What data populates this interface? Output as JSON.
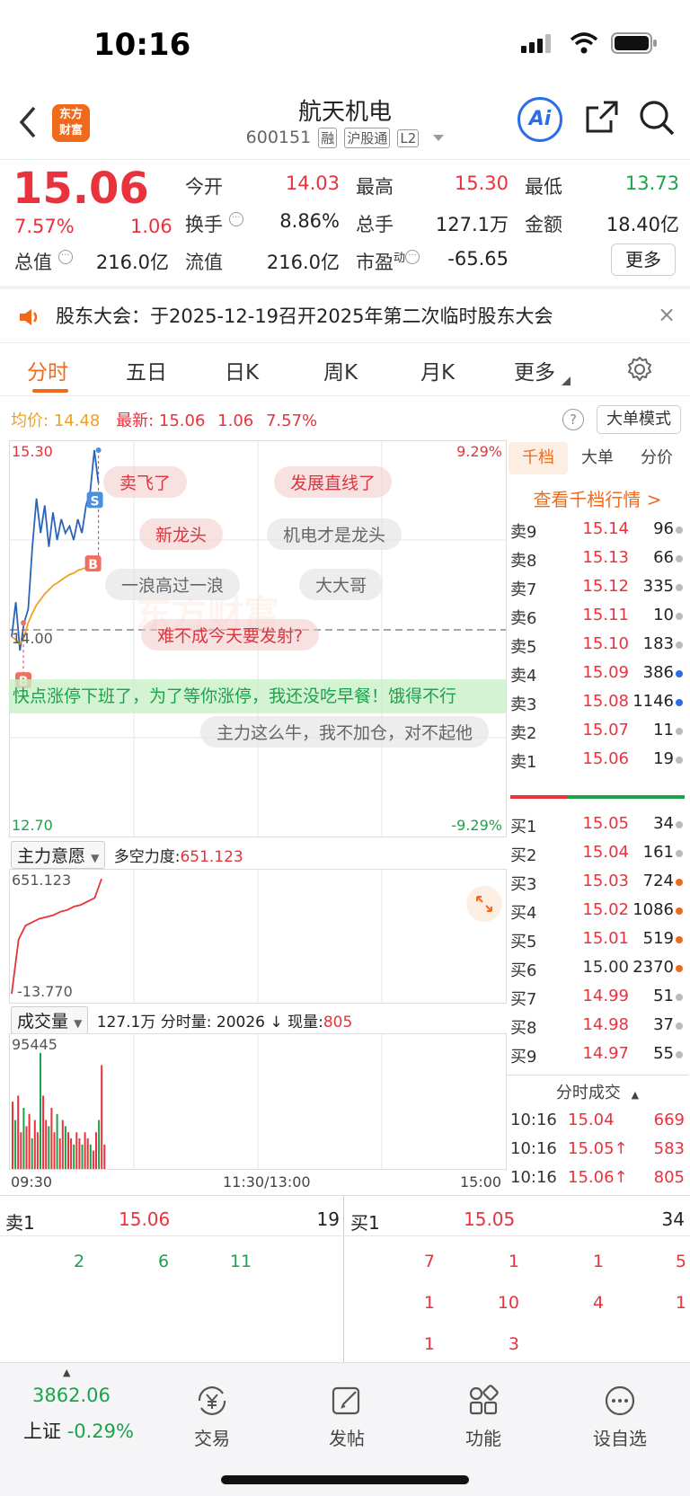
{
  "status": {
    "time": "10:16"
  },
  "header": {
    "logo_line1": "东方",
    "logo_line2": "财富",
    "name": "航天机电",
    "code": "600151",
    "tags": [
      "融",
      "沪股通",
      "L2"
    ],
    "ai_label": "Ai"
  },
  "quote": {
    "price": "15.06",
    "pct": "7.57%",
    "change": "1.06",
    "fields": [
      {
        "label": "今开",
        "value": "14.03",
        "color": "red"
      },
      {
        "label": "最高",
        "value": "15.30",
        "color": "red"
      },
      {
        "label": "最低",
        "value": "13.73",
        "color": "green"
      },
      {
        "label": "换手",
        "value": "8.86%",
        "color": "normal"
      },
      {
        "label": "总手",
        "value": "127.1万",
        "color": "normal"
      },
      {
        "label": "金额",
        "value": "18.40亿",
        "color": "normal"
      },
      {
        "label": "总值",
        "value": "216.0亿",
        "color": "normal"
      },
      {
        "label": "流值",
        "value": "216.0亿",
        "color": "normal"
      },
      {
        "label": "市盈",
        "value": "-65.65",
        "color": "normal"
      }
    ],
    "pe_sup": "动",
    "more_label": "更多"
  },
  "notice": {
    "text": "股东大会：于2025-12-19召开2025年第二次临时股东大会",
    "close": "×"
  },
  "tabs": [
    "分时",
    "五日",
    "日K",
    "周K",
    "月K",
    "更多"
  ],
  "chart_header": {
    "avg_label": "均价:",
    "avg_value": "14.48",
    "latest_label": "最新:",
    "latest_value": "15.06",
    "latest_change": "1.06",
    "latest_pct": "7.57%",
    "bigorder_label": "大单模式",
    "help": "?"
  },
  "chart_data": {
    "type": "line",
    "y_top_label": "15.30",
    "y_mid_label": "14.00",
    "y_bottom_label": "12.70",
    "pct_top_label": "9.29%",
    "pct_bottom_label": "-9.29%",
    "ylim": [
      12.7,
      15.3
    ],
    "x_labels": [
      "09:30",
      "11:30/13:00",
      "15:00"
    ],
    "series": [
      {
        "values": [
          13.95,
          14.2,
          13.85,
          14.05,
          14.15,
          14.6,
          14.95,
          14.7,
          14.9,
          14.6,
          14.85,
          14.65,
          14.8,
          14.7,
          14.75,
          14.65,
          14.8,
          14.7,
          14.9,
          15.0,
          15.3,
          15.06
        ]
      },
      {
        "values": [
          13.95,
          13.93,
          13.9,
          13.95,
          14.05,
          14.12,
          14.18,
          14.22,
          14.26,
          14.29,
          14.32,
          14.34,
          14.36,
          14.38,
          14.4,
          14.41,
          14.43,
          14.44,
          14.45,
          14.46,
          14.47,
          14.48
        ]
      }
    ],
    "markers": [
      "S",
      "B",
      "B"
    ],
    "watermark": "东方财富"
  },
  "comments": {
    "red": [
      "卖飞了",
      "发展直线了",
      "新龙头",
      "难不成今天要发射?"
    ],
    "gray": [
      "机电才是龙头",
      "一浪高过一浪",
      "大大哥",
      "主力这么牛，我不加仓，对不起他"
    ],
    "banner": "快点涨停下班了，为了等你涨停，我还没吃早餐！饿得不行"
  },
  "indicator1": {
    "name": "主力意愿",
    "label": "多空力度:",
    "value": "651.123",
    "top": "651.123",
    "bottom": "-13.770",
    "values": [
      -13.77,
      300,
      380,
      400,
      420,
      430,
      440,
      460,
      470,
      490,
      500,
      520,
      540,
      651.123
    ]
  },
  "indicator2": {
    "name": "成交量",
    "total": "127.1万",
    "minute_label": "分时量:",
    "minute_value": "20026",
    "arrow": "↓",
    "now_label": "现量:",
    "now_value": "805",
    "top": "95445",
    "bars": [
      55,
      40,
      60,
      30,
      50,
      35,
      45,
      25,
      40,
      30,
      95,
      60,
      40,
      35,
      50,
      30,
      45,
      25,
      40,
      35,
      30,
      25,
      20,
      30,
      25,
      20,
      30,
      25,
      20,
      15,
      30,
      40,
      85,
      20
    ]
  },
  "orderbook": {
    "tabs": [
      "千档",
      "大单",
      "分价"
    ],
    "link": "查看千档行情 >",
    "asks": [
      {
        "label": "卖9",
        "price": "15.14",
        "vol": "96",
        "dot": "#bbbbbb"
      },
      {
        "label": "卖8",
        "price": "15.13",
        "vol": "66",
        "dot": "#bbbbbb"
      },
      {
        "label": "卖7",
        "price": "15.12",
        "vol": "335",
        "dot": "#bbbbbb"
      },
      {
        "label": "卖6",
        "price": "15.11",
        "vol": "10",
        "dot": "#bbbbbb"
      },
      {
        "label": "卖5",
        "price": "15.10",
        "vol": "183",
        "dot": "#bbbbbb"
      },
      {
        "label": "卖4",
        "price": "15.09",
        "vol": "386",
        "dot": "#2b6de8"
      },
      {
        "label": "卖3",
        "price": "15.08",
        "vol": "1146",
        "dot": "#2b6de8"
      },
      {
        "label": "卖2",
        "price": "15.07",
        "vol": "11",
        "dot": "#bbbbbb"
      },
      {
        "label": "卖1",
        "price": "15.06",
        "vol": "19",
        "dot": "#bbbbbb"
      }
    ],
    "bids": [
      {
        "label": "买1",
        "price": "15.05",
        "vol": "34",
        "dot": "#bbbbbb"
      },
      {
        "label": "买2",
        "price": "15.04",
        "vol": "161",
        "dot": "#bbbbbb"
      },
      {
        "label": "买3",
        "price": "15.03",
        "vol": "724",
        "dot": "#f06a1b"
      },
      {
        "label": "买4",
        "price": "15.02",
        "vol": "1086",
        "dot": "#f06a1b"
      },
      {
        "label": "买5",
        "price": "15.01",
        "vol": "519",
        "dot": "#f06a1b"
      },
      {
        "label": "买6",
        "price": "15.00",
        "vol": "2370",
        "dot": "#f06a1b"
      },
      {
        "label": "买7",
        "price": "14.99",
        "vol": "51",
        "dot": "#bbbbbb"
      },
      {
        "label": "买8",
        "price": "14.98",
        "vol": "37",
        "dot": "#bbbbbb"
      },
      {
        "label": "买9",
        "price": "14.97",
        "vol": "55",
        "dot": "#bbbbbb"
      }
    ],
    "ticks_title": "分时成交",
    "ticks": [
      {
        "time": "10:16",
        "price": "15.04",
        "vol": "669"
      },
      {
        "time": "10:16",
        "price": "15.05↑",
        "vol": "583"
      },
      {
        "time": "10:16",
        "price": "15.06↑",
        "vol": "805"
      }
    ]
  },
  "level1": {
    "sell_label": "卖1",
    "sell_price": "15.06",
    "sell_vol": "19",
    "buy_label": "买1",
    "buy_price": "15.05",
    "buy_vol": "34",
    "sell_queue": [
      "2",
      "6",
      "11"
    ],
    "buy_queue": [
      "7",
      "1",
      "1",
      "5",
      "1",
      "10",
      "4",
      "1",
      "1",
      "3"
    ]
  },
  "bottom_nav": {
    "index_value": "3862.06",
    "index_name": "上证",
    "index_pct": "-0.29%",
    "items": [
      "交易",
      "发帖",
      "功能",
      "设自选"
    ]
  }
}
